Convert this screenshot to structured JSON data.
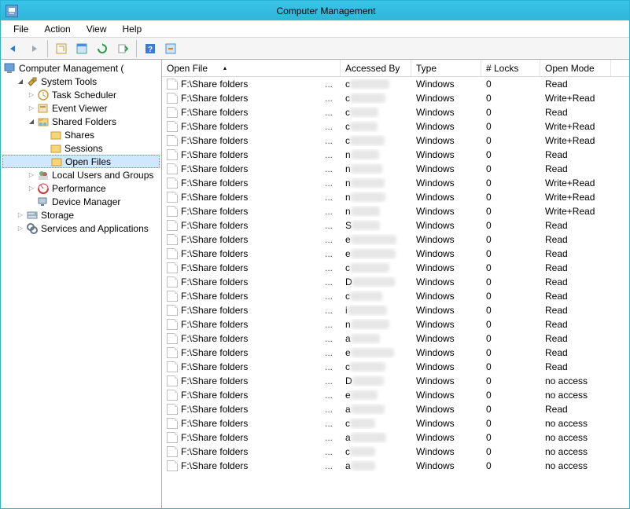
{
  "window": {
    "title": "Computer Management"
  },
  "menu": {
    "file": "File",
    "action": "Action",
    "view": "View",
    "help": "Help"
  },
  "nav": {
    "root": "Computer Management (",
    "system_tools": "System Tools",
    "task_scheduler": "Task Scheduler",
    "event_viewer": "Event Viewer",
    "shared_folders": "Shared Folders",
    "shares": "Shares",
    "sessions": "Sessions",
    "open_files": "Open Files",
    "local_users": "Local Users and Groups",
    "performance": "Performance",
    "device_manager": "Device Manager",
    "storage": "Storage",
    "services": "Services and Applications"
  },
  "columns": {
    "open_file": "Open File",
    "accessed_by": "Accessed By",
    "type": "Type",
    "locks": "# Locks",
    "open_mode": "Open Mode"
  },
  "rows": [
    {
      "file": "F:\\Share folders",
      "accessed_by": "c",
      "type": "Windows",
      "locks": "0",
      "mode": "Read"
    },
    {
      "file": "F:\\Share folders",
      "accessed_by": "c",
      "type": "Windows",
      "locks": "0",
      "mode": "Write+Read"
    },
    {
      "file": "F:\\Share folders",
      "accessed_by": "c",
      "type": "Windows",
      "locks": "0",
      "mode": "Read"
    },
    {
      "file": "F:\\Share folders",
      "accessed_by": "c",
      "type": "Windows",
      "locks": "0",
      "mode": "Write+Read"
    },
    {
      "file": "F:\\Share folders",
      "accessed_by": "c",
      "type": "Windows",
      "locks": "0",
      "mode": "Write+Read"
    },
    {
      "file": "F:\\Share folders",
      "accessed_by": "n",
      "type": "Windows",
      "locks": "0",
      "mode": "Read"
    },
    {
      "file": "F:\\Share folders",
      "accessed_by": "n",
      "type": "Windows",
      "locks": "0",
      "mode": "Read"
    },
    {
      "file": "F:\\Share folders",
      "accessed_by": "n",
      "type": "Windows",
      "locks": "0",
      "mode": "Write+Read"
    },
    {
      "file": "F:\\Share folders",
      "accessed_by": "n",
      "type": "Windows",
      "locks": "0",
      "mode": "Write+Read"
    },
    {
      "file": "F:\\Share folders",
      "accessed_by": "n",
      "type": "Windows",
      "locks": "0",
      "mode": "Write+Read"
    },
    {
      "file": "F:\\Share folders",
      "accessed_by": "S",
      "type": "Windows",
      "locks": "0",
      "mode": "Read"
    },
    {
      "file": "F:\\Share folders",
      "accessed_by": "e",
      "type": "Windows",
      "locks": "0",
      "mode": "Read"
    },
    {
      "file": "F:\\Share folders",
      "accessed_by": "e",
      "type": "Windows",
      "locks": "0",
      "mode": "Read"
    },
    {
      "file": "F:\\Share folders",
      "accessed_by": "c",
      "type": "Windows",
      "locks": "0",
      "mode": "Read"
    },
    {
      "file": "F:\\Share folders",
      "accessed_by": "D",
      "type": "Windows",
      "locks": "0",
      "mode": "Read"
    },
    {
      "file": "F:\\Share folders",
      "accessed_by": "c",
      "type": "Windows",
      "locks": "0",
      "mode": "Read"
    },
    {
      "file": "F:\\Share folders",
      "accessed_by": "i",
      "type": "Windows",
      "locks": "0",
      "mode": "Read"
    },
    {
      "file": "F:\\Share folders",
      "accessed_by": "n",
      "type": "Windows",
      "locks": "0",
      "mode": "Read"
    },
    {
      "file": "F:\\Share folders",
      "accessed_by": "a",
      "type": "Windows",
      "locks": "0",
      "mode": "Read"
    },
    {
      "file": "F:\\Share folders",
      "accessed_by": "e",
      "type": "Windows",
      "locks": "0",
      "mode": "Read"
    },
    {
      "file": "F:\\Share folders",
      "accessed_by": "c",
      "type": "Windows",
      "locks": "0",
      "mode": "Read"
    },
    {
      "file": "F:\\Share folders",
      "accessed_by": "D",
      "type": "Windows",
      "locks": "0",
      "mode": "no access"
    },
    {
      "file": "F:\\Share folders",
      "accessed_by": "e",
      "type": "Windows",
      "locks": "0",
      "mode": "no access"
    },
    {
      "file": "F:\\Share folders",
      "accessed_by": "a",
      "type": "Windows",
      "locks": "0",
      "mode": "Read"
    },
    {
      "file": "F:\\Share folders",
      "accessed_by": "c",
      "type": "Windows",
      "locks": "0",
      "mode": "no access"
    },
    {
      "file": "F:\\Share folders",
      "accessed_by": "a",
      "type": "Windows",
      "locks": "0",
      "mode": "no access"
    },
    {
      "file": "F:\\Share folders",
      "accessed_by": "c",
      "type": "Windows",
      "locks": "0",
      "mode": "no access"
    },
    {
      "file": "F:\\Share folders",
      "accessed_by": "a",
      "type": "Windows",
      "locks": "0",
      "mode": "no access"
    }
  ]
}
